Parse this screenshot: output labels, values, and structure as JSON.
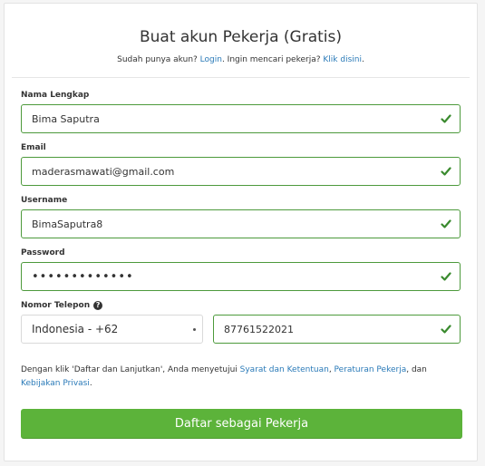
{
  "header": {
    "title": "Buat akun Pekerja (Gratis)",
    "have_account_text": "Sudah punya akun?",
    "login_link": "Login",
    "looking_text": ". Ingin mencari pekerja?",
    "click_here_link": "Klik disini",
    "period": "."
  },
  "form": {
    "full_name": {
      "label": "Nama Lengkap",
      "value": "Bima Saputra"
    },
    "email": {
      "label": "Email",
      "value": "maderasmawati@gmail.com"
    },
    "username": {
      "label": "Username",
      "value": "BimaSaputra8"
    },
    "password": {
      "label": "Password",
      "value": "•••••••••••••"
    },
    "phone": {
      "label": "Nomor Telepon",
      "help_glyph": "?",
      "country_selected": "Indonesia - +62",
      "number": "87761522021"
    }
  },
  "terms": {
    "prefix": "Dengan klik 'Daftar dan Lanjutkan', Anda menyetujui ",
    "terms_link": "Syarat dan Ketentuan",
    "comma": ", ",
    "worker_rules_link": "Peraturan Pekerja",
    "and": ", dan",
    "privacy_link": "Kebijakan Privasi",
    "period": "."
  },
  "submit_label": "Daftar sebagai Pekerja",
  "icons": {
    "valid": "check-icon",
    "help": "question-circle-icon",
    "dropdown": "caret-icon"
  },
  "colors": {
    "accent_green": "#5cb33a",
    "valid_border": "#4d9a3c",
    "link_blue": "#2a7ab8"
  }
}
